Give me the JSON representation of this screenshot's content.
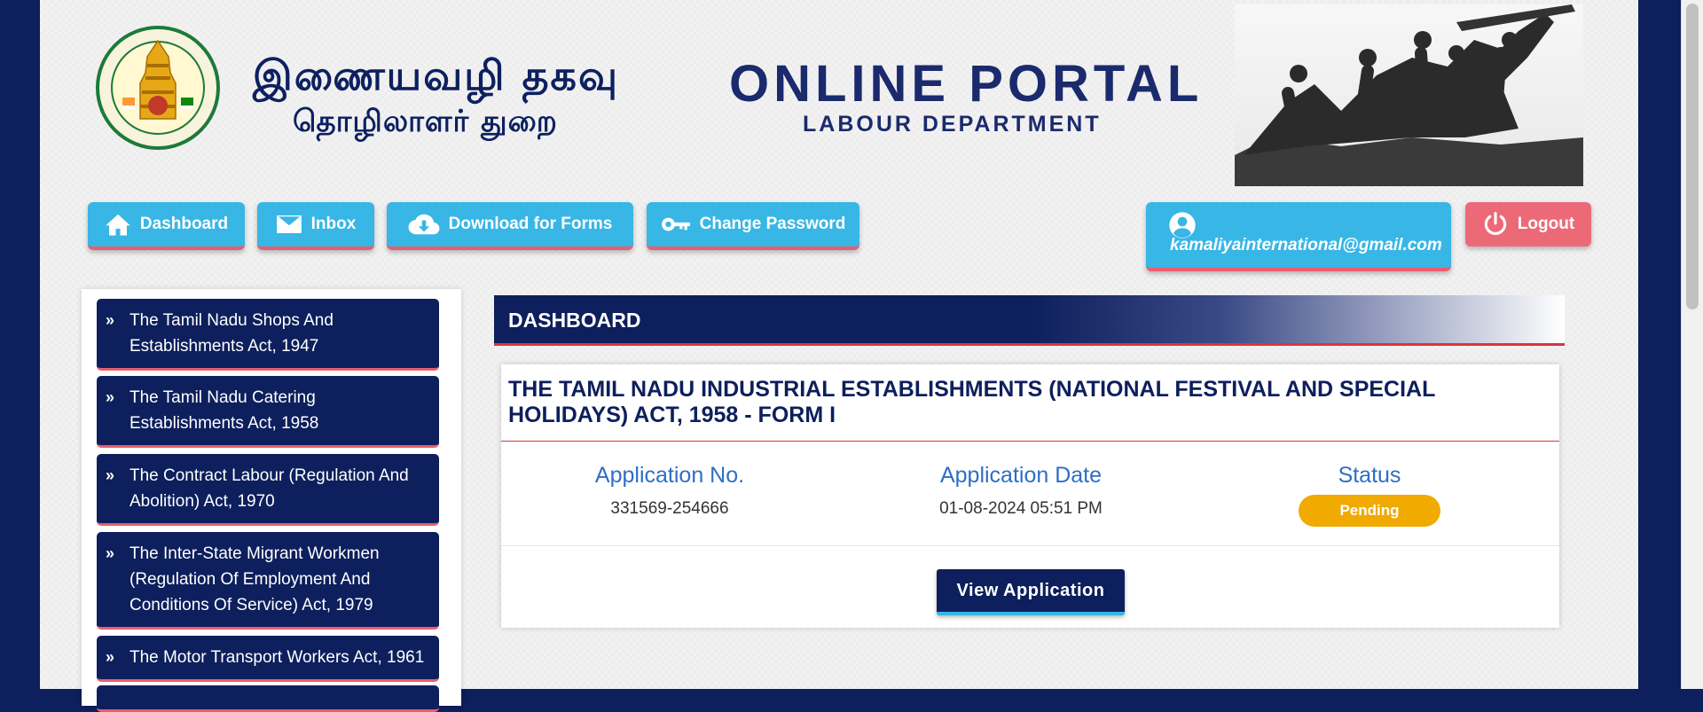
{
  "header": {
    "tamil_title": "இணையவழி தகவு",
    "tamil_subtitle": "தொழிலாளர் துறை",
    "portal_title": "ONLINE PORTAL",
    "portal_subtitle": "LABOUR DEPARTMENT",
    "emblem_icon": "tamil-nadu-emblem-icon",
    "statue_image": "labour-statue-image"
  },
  "nav": {
    "dashboard": "Dashboard",
    "inbox": "Inbox",
    "download_forms": "Download for Forms",
    "change_password": "Change Password",
    "user_email": "kamaliyainternational@gmail.com",
    "logout": "Logout"
  },
  "sidebar": {
    "items": [
      {
        "label": "The Tamil Nadu Shops And Establishments Act, 1947"
      },
      {
        "label": "The Tamil Nadu Catering Establishments Act, 1958"
      },
      {
        "label": "The Contract Labour (Regulation And Abolition) Act, 1970"
      },
      {
        "label": "The Inter-State Migrant Workmen (Regulation Of Employment And Conditions Of Service) Act, 1979"
      },
      {
        "label": "The Motor Transport Workers Act, 1961"
      }
    ]
  },
  "main": {
    "section_title": "DASHBOARD",
    "card": {
      "title": "THE TAMIL NADU INDUSTRIAL ESTABLISHMENTS (NATIONAL FESTIVAL AND SPECIAL HOLIDAYS) ACT, 1958 - FORM I",
      "app_no_label": "Application No.",
      "app_no_value": "331569-254666",
      "app_date_label": "Application Date",
      "app_date_value": "01-08-2024 05:51 PM",
      "status_label": "Status",
      "status_value": "Pending",
      "view_button": "View Application"
    }
  },
  "colors": {
    "navy": "#0d1f5c",
    "sky": "#38b6e6",
    "accent_red": "#e85e6f",
    "pending": "#f0aa00",
    "link_blue": "#2f6ec4"
  }
}
